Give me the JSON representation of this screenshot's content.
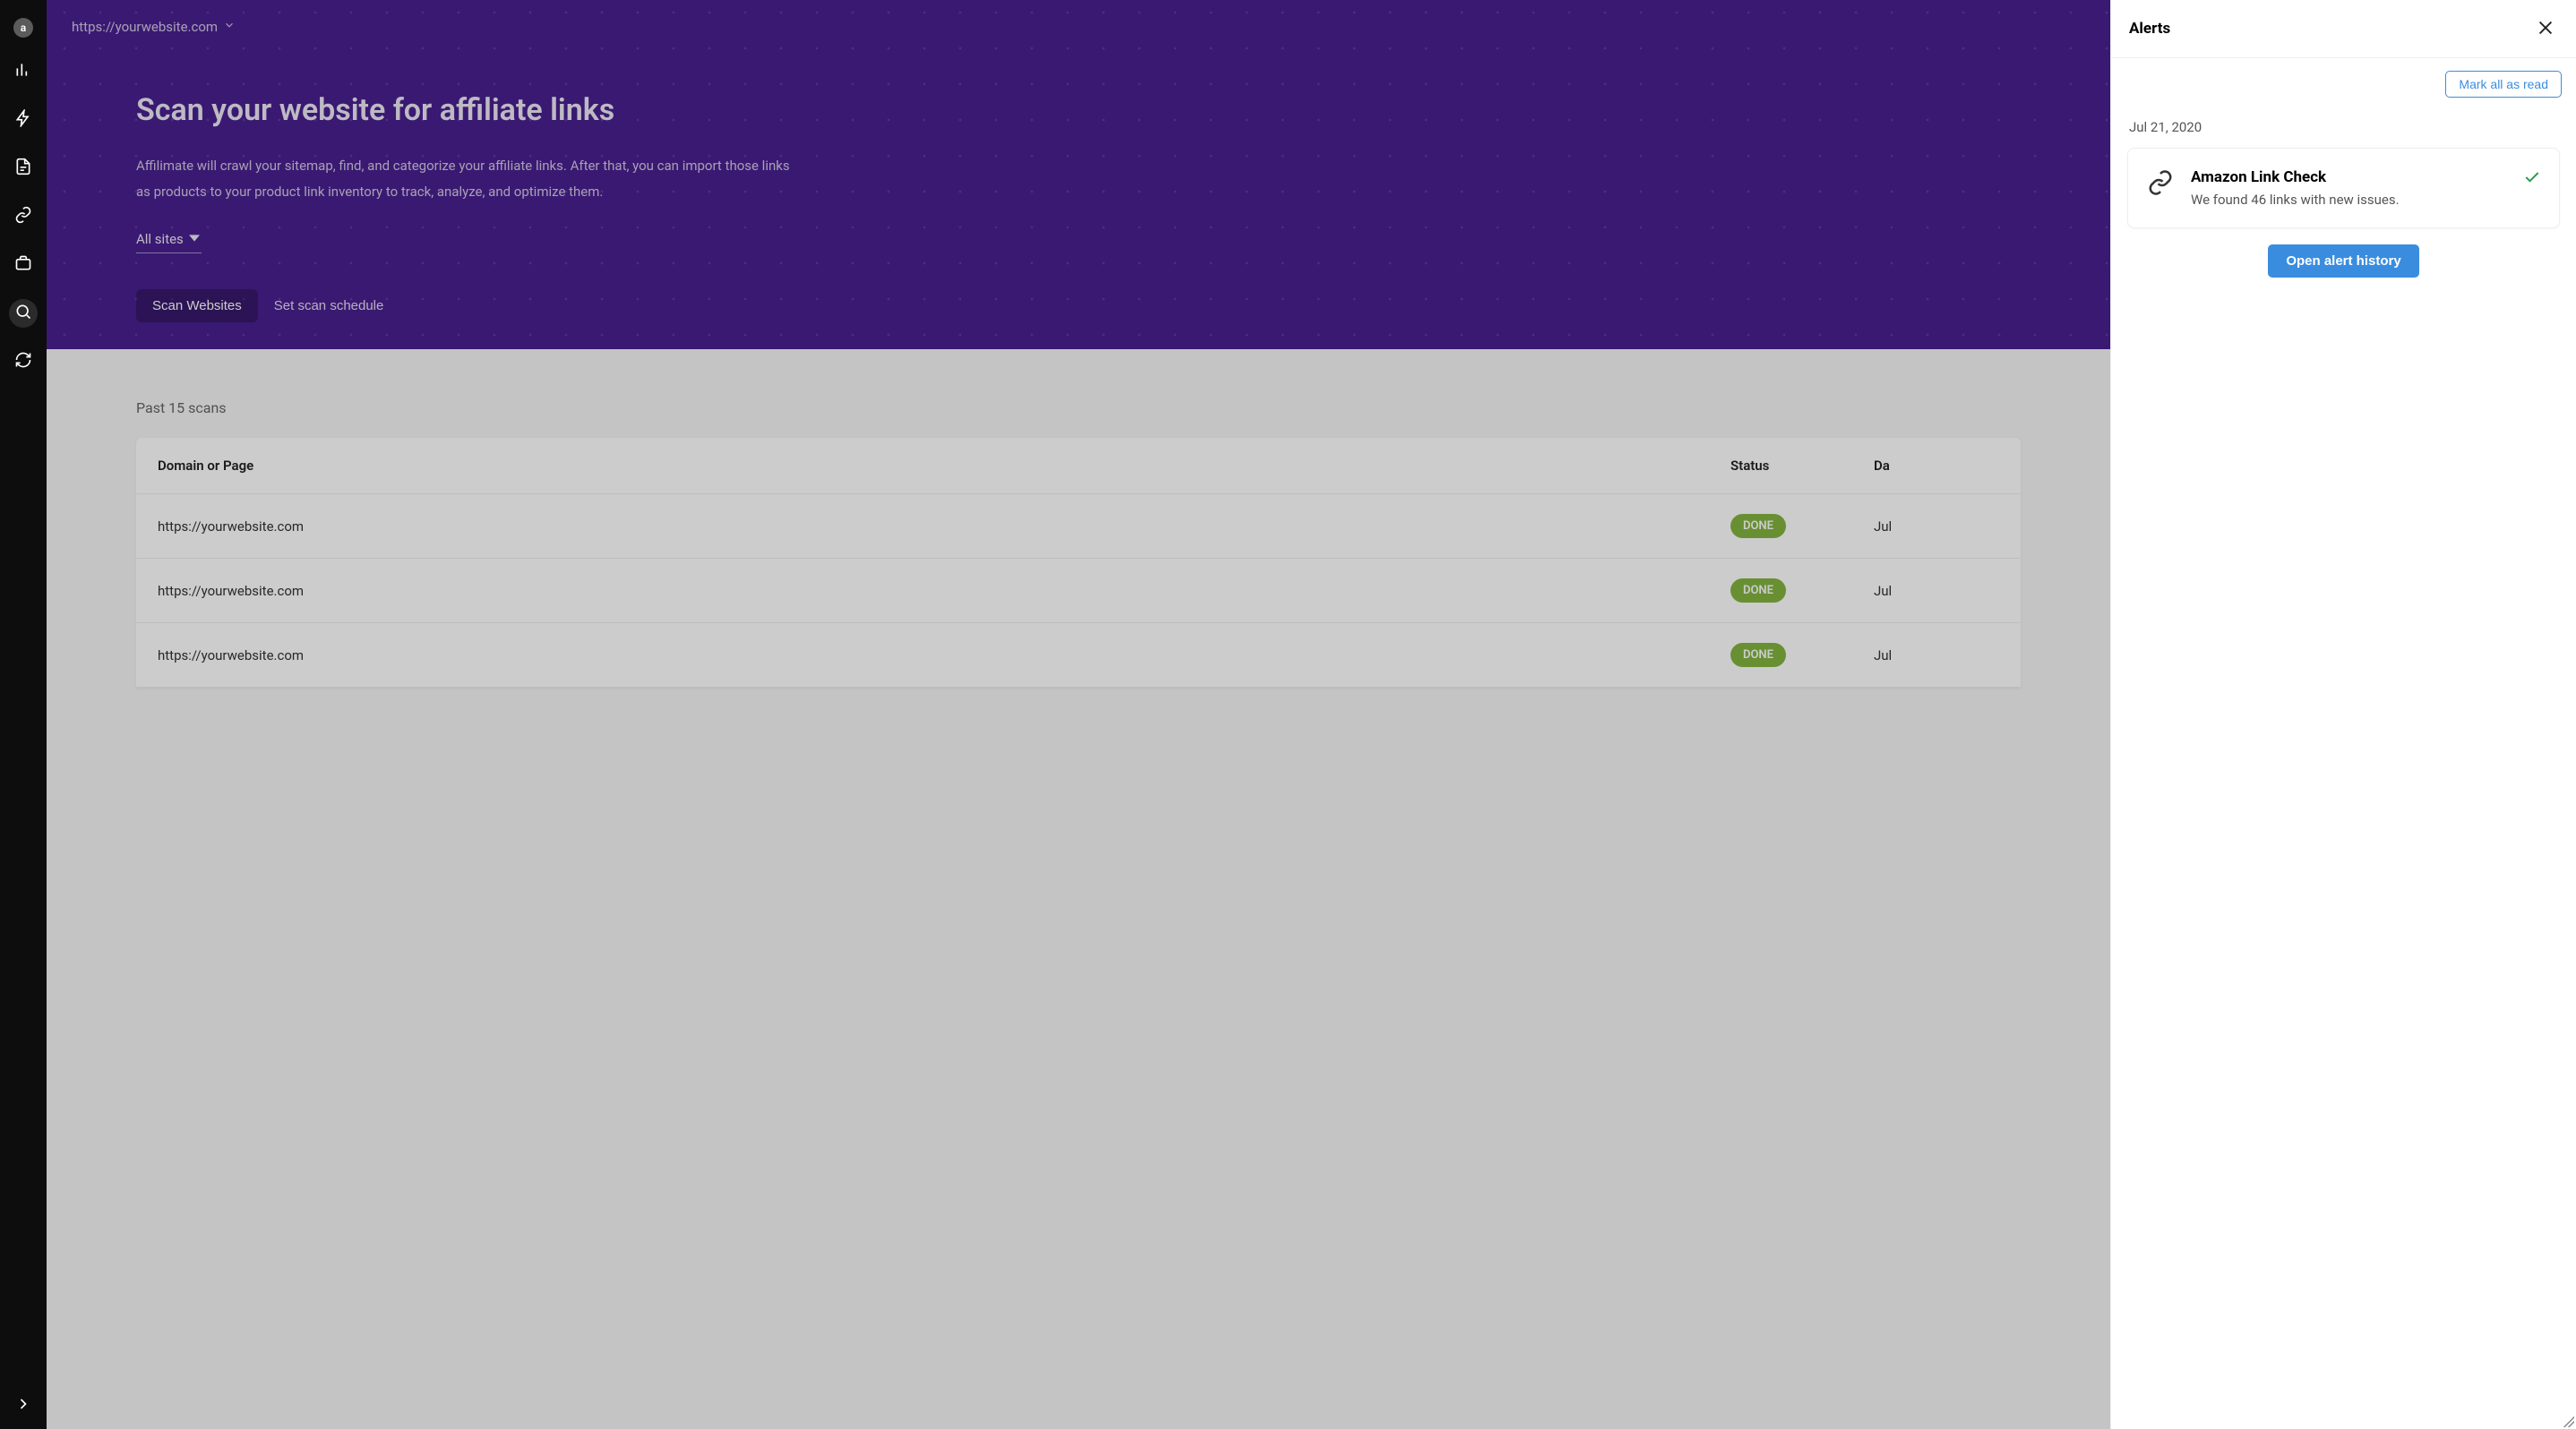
{
  "sidebar": {
    "avatar_initial": "a",
    "items": [
      {
        "name": "analytics-icon"
      },
      {
        "name": "bolt-icon"
      },
      {
        "name": "page-icon"
      },
      {
        "name": "link-icon"
      },
      {
        "name": "briefcase-icon"
      },
      {
        "name": "search-icon",
        "active": true
      },
      {
        "name": "refresh-icon"
      }
    ]
  },
  "breadcrumb": {
    "site": "https://yourwebsite.com"
  },
  "hero": {
    "title": "Scan your website for affiliate links",
    "description": "Affilimate will crawl your sitemap, find, and categorize your affiliate links. After that, you can import those links as products to your product link inventory to track, analyze, and optimize them.",
    "site_filter": "All sites",
    "scan_button": "Scan Websites",
    "schedule_button": "Set scan schedule"
  },
  "scans": {
    "section_title": "Past 15 scans",
    "columns": {
      "domain": "Domain or Page",
      "status": "Status",
      "date": "Da"
    },
    "rows": [
      {
        "domain": "https://yourwebsite.com",
        "status": "DONE",
        "date": "Jul"
      },
      {
        "domain": "https://yourwebsite.com",
        "status": "DONE",
        "date": "Jul"
      },
      {
        "domain": "https://yourwebsite.com",
        "status": "DONE",
        "date": "Jul"
      }
    ]
  },
  "alerts": {
    "title": "Alerts",
    "mark_all": "Mark all as read",
    "open_history": "Open alert history",
    "groups": [
      {
        "date": "Jul 21, 2020",
        "items": [
          {
            "title": "Amazon Link Check",
            "message": "We found 46 links with new issues."
          }
        ]
      }
    ]
  }
}
